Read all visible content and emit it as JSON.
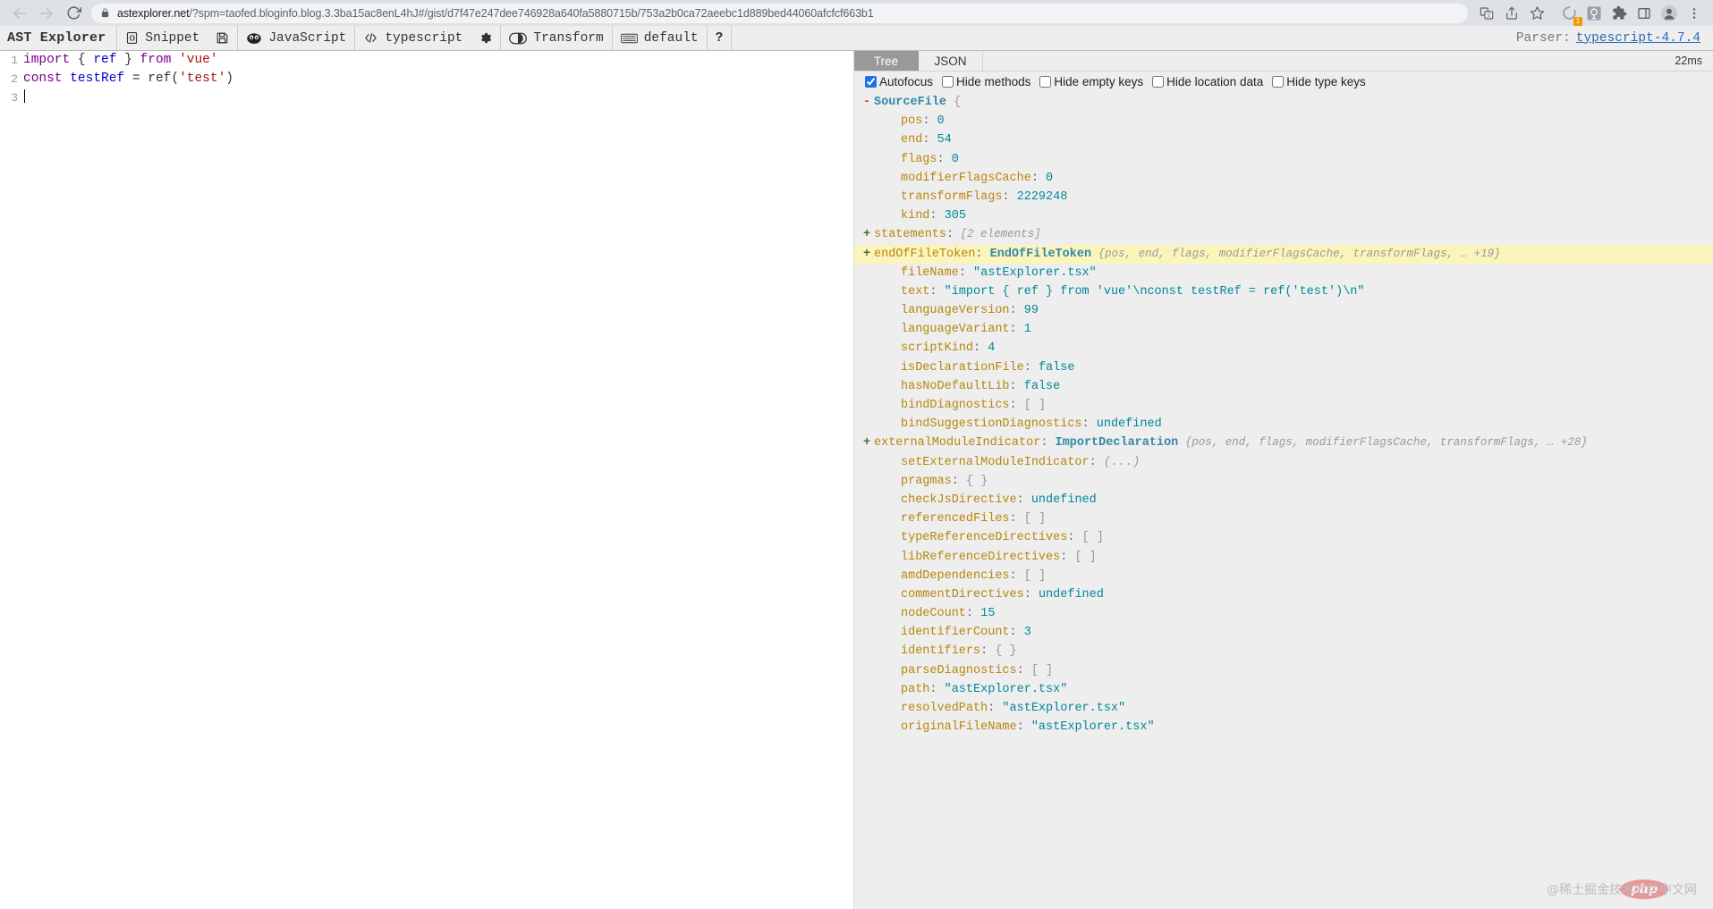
{
  "browser": {
    "back_icon": "arrow-left-icon",
    "forward_icon": "arrow-right-icon",
    "reload_icon": "reload-icon",
    "lock_icon": "lock-icon",
    "url_host": "astexplorer.net",
    "url_path": "/?spm=taofed.bloginfo.blog.3.3ba15ac8enL4hJ#/gist/d7f47e247dee746928a640fa5880715b/753a2b0ca72aeebc1d889bed44060afcfcf663b1",
    "actions": [
      {
        "name": "translate-icon",
        "glyph": "translate"
      },
      {
        "name": "share-icon",
        "glyph": "share"
      },
      {
        "name": "bookmark-star-icon",
        "glyph": "star"
      },
      {
        "name": "extension-loading-icon",
        "glyph": "ring",
        "badge": "1"
      },
      {
        "name": "avatar-extension-icon",
        "glyph": "face"
      },
      {
        "name": "extensions-puzzle-icon",
        "glyph": "puzzle"
      },
      {
        "name": "side-panel-icon",
        "glyph": "panel"
      },
      {
        "name": "profile-icon",
        "glyph": "person"
      },
      {
        "name": "chrome-menu-icon",
        "glyph": "kebab"
      }
    ]
  },
  "app": {
    "title": "AST Explorer",
    "toolbar": [
      {
        "icon": "snippet-icon",
        "label": "Snippet"
      },
      {
        "icon": "save-icon",
        "label": ""
      },
      {
        "icon": "javascript-icon",
        "label": "JavaScript"
      },
      {
        "icon": "code-icon",
        "label": "typescript"
      },
      {
        "icon": "gear-icon",
        "label": ""
      },
      {
        "icon": "transform-toggle-icon",
        "label": "Transform"
      },
      {
        "icon": "keyboard-icon",
        "label": "default"
      },
      {
        "icon": "help-icon",
        "label": "?"
      }
    ],
    "parser_label": "Parser:",
    "parser_version": "typescript-4.7.4"
  },
  "editor": {
    "lines": [
      {
        "number": "1",
        "tokens": [
          {
            "t": "import",
            "c": "tok-kw"
          },
          {
            "t": " ",
            "c": "tok-plain"
          },
          {
            "t": "{",
            "c": "tok-plain"
          },
          {
            "t": " ",
            "c": "tok-plain"
          },
          {
            "t": "ref",
            "c": "tok-def"
          },
          {
            "t": " ",
            "c": "tok-plain"
          },
          {
            "t": "}",
            "c": "tok-plain"
          },
          {
            "t": " ",
            "c": "tok-plain"
          },
          {
            "t": "from",
            "c": "tok-kw"
          },
          {
            "t": " ",
            "c": "tok-plain"
          },
          {
            "t": "'vue'",
            "c": "tok-str"
          }
        ]
      },
      {
        "number": "2",
        "tokens": [
          {
            "t": "const",
            "c": "tok-kw"
          },
          {
            "t": " ",
            "c": "tok-plain"
          },
          {
            "t": "testRef",
            "c": "tok-def"
          },
          {
            "t": " = ",
            "c": "tok-plain"
          },
          {
            "t": "ref",
            "c": "tok-plain"
          },
          {
            "t": "(",
            "c": "tok-plain"
          },
          {
            "t": "'test'",
            "c": "tok-str"
          },
          {
            "t": ")",
            "c": "tok-plain"
          }
        ]
      },
      {
        "number": "3",
        "tokens": []
      }
    ]
  },
  "tree_panel": {
    "tabs": [
      {
        "label": "Tree",
        "active": true
      },
      {
        "label": "JSON",
        "active": false
      }
    ],
    "timing": "22ms",
    "options": [
      {
        "label": "Autofocus",
        "checked": true
      },
      {
        "label": "Hide methods",
        "checked": false
      },
      {
        "label": "Hide empty keys",
        "checked": false
      },
      {
        "label": "Hide location data",
        "checked": false
      },
      {
        "label": "Hide type keys",
        "checked": false
      }
    ],
    "nodes": [
      {
        "toggle": "-",
        "indent": 0,
        "key": "SourceFile",
        "keyClass": "k-type",
        "sep": "",
        "value": "{",
        "valueClass": "k-punct"
      },
      {
        "toggle": "",
        "indent": 1,
        "key": "pos",
        "keyClass": "k-prop",
        "sep": ":",
        "value": "0",
        "valueClass": "k-num"
      },
      {
        "toggle": "",
        "indent": 1,
        "key": "end",
        "keyClass": "k-prop",
        "sep": ":",
        "value": "54",
        "valueClass": "k-num"
      },
      {
        "toggle": "",
        "indent": 1,
        "key": "flags",
        "keyClass": "k-prop",
        "sep": ":",
        "value": "0",
        "valueClass": "k-num"
      },
      {
        "toggle": "",
        "indent": 1,
        "key": "modifierFlagsCache",
        "keyClass": "k-prop",
        "sep": ":",
        "value": "0",
        "valueClass": "k-num"
      },
      {
        "toggle": "",
        "indent": 1,
        "key": "transformFlags",
        "keyClass": "k-prop",
        "sep": ":",
        "value": "2229248",
        "valueClass": "k-num"
      },
      {
        "toggle": "",
        "indent": 1,
        "key": "kind",
        "keyClass": "k-prop",
        "sep": ":",
        "value": "305",
        "valueClass": "k-num"
      },
      {
        "toggle": "+",
        "indent": 0,
        "key": "statements",
        "keyClass": "k-prop",
        "sep": ":",
        "value": "[2 elements]",
        "valueClass": "k-meta"
      },
      {
        "toggle": "+",
        "indent": 0,
        "key": "endOfFileToken",
        "keyClass": "k-prop",
        "sep": ":",
        "type": "EndOfFileToken",
        "value": "{pos, end, flags, modifierFlagsCache, transformFlags, … +19}",
        "valueClass": "k-meta",
        "highlight": true
      },
      {
        "toggle": "",
        "indent": 1,
        "key": "fileName",
        "keyClass": "k-prop",
        "sep": ":",
        "value": "\"astExplorer.tsx\"",
        "valueClass": "k-str"
      },
      {
        "toggle": "",
        "indent": 1,
        "key": "text",
        "keyClass": "k-prop",
        "sep": ":",
        "value": "\"import { ref } from 'vue'\\nconst testRef = ref('test')\\n\"",
        "valueClass": "k-str"
      },
      {
        "toggle": "",
        "indent": 1,
        "key": "languageVersion",
        "keyClass": "k-prop",
        "sep": ":",
        "value": "99",
        "valueClass": "k-num"
      },
      {
        "toggle": "",
        "indent": 1,
        "key": "languageVariant",
        "keyClass": "k-prop",
        "sep": ":",
        "value": "1",
        "valueClass": "k-num"
      },
      {
        "toggle": "",
        "indent": 1,
        "key": "scriptKind",
        "keyClass": "k-prop",
        "sep": ":",
        "value": "4",
        "valueClass": "k-num"
      },
      {
        "toggle": "",
        "indent": 1,
        "key": "isDeclarationFile",
        "keyClass": "k-prop",
        "sep": ":",
        "value": "false",
        "valueClass": "k-bool"
      },
      {
        "toggle": "",
        "indent": 1,
        "key": "hasNoDefaultLib",
        "keyClass": "k-prop",
        "sep": ":",
        "value": "false",
        "valueClass": "k-bool"
      },
      {
        "toggle": "",
        "indent": 1,
        "key": "bindDiagnostics",
        "keyClass": "k-prop",
        "sep": ":",
        "value": "[ ]",
        "valueClass": "k-punct"
      },
      {
        "toggle": "",
        "indent": 1,
        "key": "bindSuggestionDiagnostics",
        "keyClass": "k-prop",
        "sep": ":",
        "value": "undefined",
        "valueClass": "k-undef"
      },
      {
        "toggle": "+",
        "indent": 0,
        "key": "externalModuleIndicator",
        "keyClass": "k-prop",
        "sep": ":",
        "type": "ImportDeclaration",
        "value": "{pos, end, flags, modifierFlagsCache, transformFlags, … +28}",
        "valueClass": "k-meta"
      },
      {
        "toggle": "",
        "indent": 1,
        "key": "setExternalModuleIndicator",
        "keyClass": "k-prop",
        "sep": ":",
        "value": "(...)",
        "valueClass": "k-fn"
      },
      {
        "toggle": "",
        "indent": 1,
        "key": "pragmas",
        "keyClass": "k-prop",
        "sep": ":",
        "value": "{ }",
        "valueClass": "k-punct"
      },
      {
        "toggle": "",
        "indent": 1,
        "key": "checkJsDirective",
        "keyClass": "k-prop",
        "sep": ":",
        "value": "undefined",
        "valueClass": "k-undef"
      },
      {
        "toggle": "",
        "indent": 1,
        "key": "referencedFiles",
        "keyClass": "k-prop",
        "sep": ":",
        "value": "[ ]",
        "valueClass": "k-punct"
      },
      {
        "toggle": "",
        "indent": 1,
        "key": "typeReferenceDirectives",
        "keyClass": "k-prop",
        "sep": ":",
        "value": "[ ]",
        "valueClass": "k-punct"
      },
      {
        "toggle": "",
        "indent": 1,
        "key": "libReferenceDirectives",
        "keyClass": "k-prop",
        "sep": ":",
        "value": "[ ]",
        "valueClass": "k-punct"
      },
      {
        "toggle": "",
        "indent": 1,
        "key": "amdDependencies",
        "keyClass": "k-prop",
        "sep": ":",
        "value": "[ ]",
        "valueClass": "k-punct"
      },
      {
        "toggle": "",
        "indent": 1,
        "key": "commentDirectives",
        "keyClass": "k-prop",
        "sep": ":",
        "value": "undefined",
        "valueClass": "k-undef"
      },
      {
        "toggle": "",
        "indent": 1,
        "key": "nodeCount",
        "keyClass": "k-prop",
        "sep": ":",
        "value": "15",
        "valueClass": "k-num"
      },
      {
        "toggle": "",
        "indent": 1,
        "key": "identifierCount",
        "keyClass": "k-prop",
        "sep": ":",
        "value": "3",
        "valueClass": "k-num"
      },
      {
        "toggle": "",
        "indent": 1,
        "key": "identifiers",
        "keyClass": "k-prop",
        "sep": ":",
        "value": "{ }",
        "valueClass": "k-punct"
      },
      {
        "toggle": "",
        "indent": 1,
        "key": "parseDiagnostics",
        "keyClass": "k-prop",
        "sep": ":",
        "value": "[ ]",
        "valueClass": "k-punct"
      },
      {
        "toggle": "",
        "indent": 1,
        "key": "path",
        "keyClass": "k-prop",
        "sep": ":",
        "value": "\"astExplorer.tsx\"",
        "valueClass": "k-str"
      },
      {
        "toggle": "",
        "indent": 1,
        "key": "resolvedPath",
        "keyClass": "k-prop",
        "sep": ":",
        "value": "\"astExplorer.tsx\"",
        "valueClass": "k-str"
      },
      {
        "toggle": "",
        "indent": 1,
        "key": "originalFileName",
        "keyClass": "k-prop",
        "sep": ":",
        "value": "\"astExplorer.tsx\"",
        "valueClass": "k-str"
      }
    ],
    "watermark": "@稀土掘金技术社区",
    "watermark_overlay": "php",
    "watermark_suffix": "中文网"
  },
  "colors": {
    "highlight": "#fbf5bb",
    "tab_active_bg": "#999999",
    "link": "#2b6cb0",
    "tree_bg": "#eeeeee"
  }
}
